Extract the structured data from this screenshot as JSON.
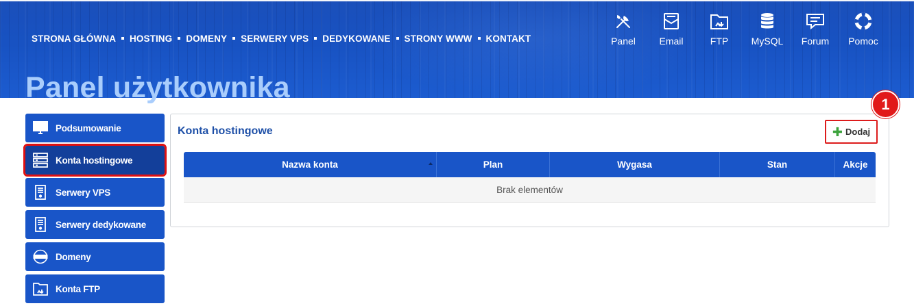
{
  "topnav": {
    "items": [
      "STRONA GŁÓWNA",
      "HOSTING",
      "DOMENY",
      "SERWERY VPS",
      "DEDYKOWANE",
      "STRONY WWW",
      "KONTAKT"
    ]
  },
  "quick_links": [
    {
      "label": "Panel",
      "icon": "tools-icon"
    },
    {
      "label": "Email",
      "icon": "email-icon"
    },
    {
      "label": "FTP",
      "icon": "ftp-folder-icon"
    },
    {
      "label": "MySQL",
      "icon": "database-icon"
    },
    {
      "label": "Forum",
      "icon": "forum-icon"
    },
    {
      "label": "Pomoc",
      "icon": "lifebuoy-icon"
    }
  ],
  "page_title": "Panel użytkownika",
  "sidebar": {
    "items": [
      {
        "label": "Podsumowanie",
        "icon": "monitor-icon",
        "active": false
      },
      {
        "label": "Konta hostingowe",
        "icon": "server-stack-icon",
        "active": true
      },
      {
        "label": "Serwery VPS",
        "icon": "server-tower-icon",
        "active": false
      },
      {
        "label": "Serwery dedykowane",
        "icon": "server-tower-icon",
        "active": false
      },
      {
        "label": "Domeny",
        "icon": "www-globe-icon",
        "active": false
      },
      {
        "label": "Konta FTP",
        "icon": "ftp-folder-icon",
        "active": false
      }
    ]
  },
  "main": {
    "title": "Konta hostingowe",
    "add_button": {
      "label": "Dodaj",
      "icon": "plus-icon"
    },
    "annotation_badge": "1",
    "table": {
      "columns": [
        "Nazwa konta",
        "Plan",
        "Wygasa",
        "Stan",
        "Akcje"
      ],
      "sorted_column": "Nazwa konta",
      "rows": [],
      "empty_text": "Brak elementów"
    }
  },
  "colors": {
    "primary_blue": "#1955c8",
    "active_blue": "#133f9a",
    "title_light_blue": "#a9cdfc",
    "highlight_red": "#e01010",
    "plus_green": "#3da33d"
  }
}
